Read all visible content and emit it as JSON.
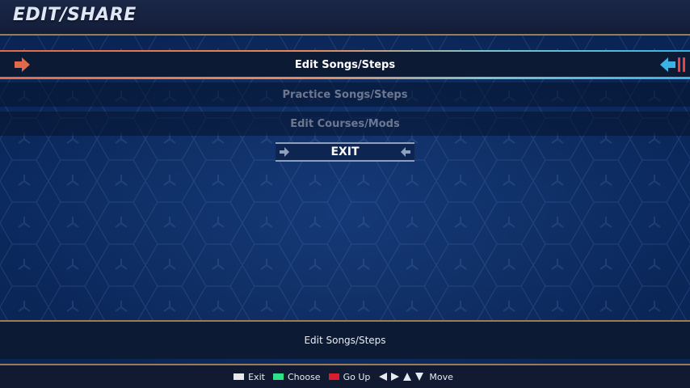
{
  "header": {
    "title": "EDIT/SHARE"
  },
  "menu": {
    "items": [
      {
        "label": "Edit Songs/Steps",
        "selected": true
      },
      {
        "label": "Practice Songs/Steps",
        "selected": false
      },
      {
        "label": "Edit Courses/Mods",
        "selected": false
      }
    ],
    "exit_label": "EXIT"
  },
  "description": "Edit Songs/Steps",
  "controls": {
    "exit": {
      "label": "Exit",
      "color": "#e8e8e8"
    },
    "choose": {
      "label": "Choose",
      "color": "#2ee08a"
    },
    "go_up": {
      "label": "Go Up",
      "color": "#d81e2a"
    },
    "move": {
      "label": "Move"
    }
  },
  "colors": {
    "accent_left": "#e06a4a",
    "accent_right": "#3ab2e6",
    "divider": "#9a7c55"
  }
}
